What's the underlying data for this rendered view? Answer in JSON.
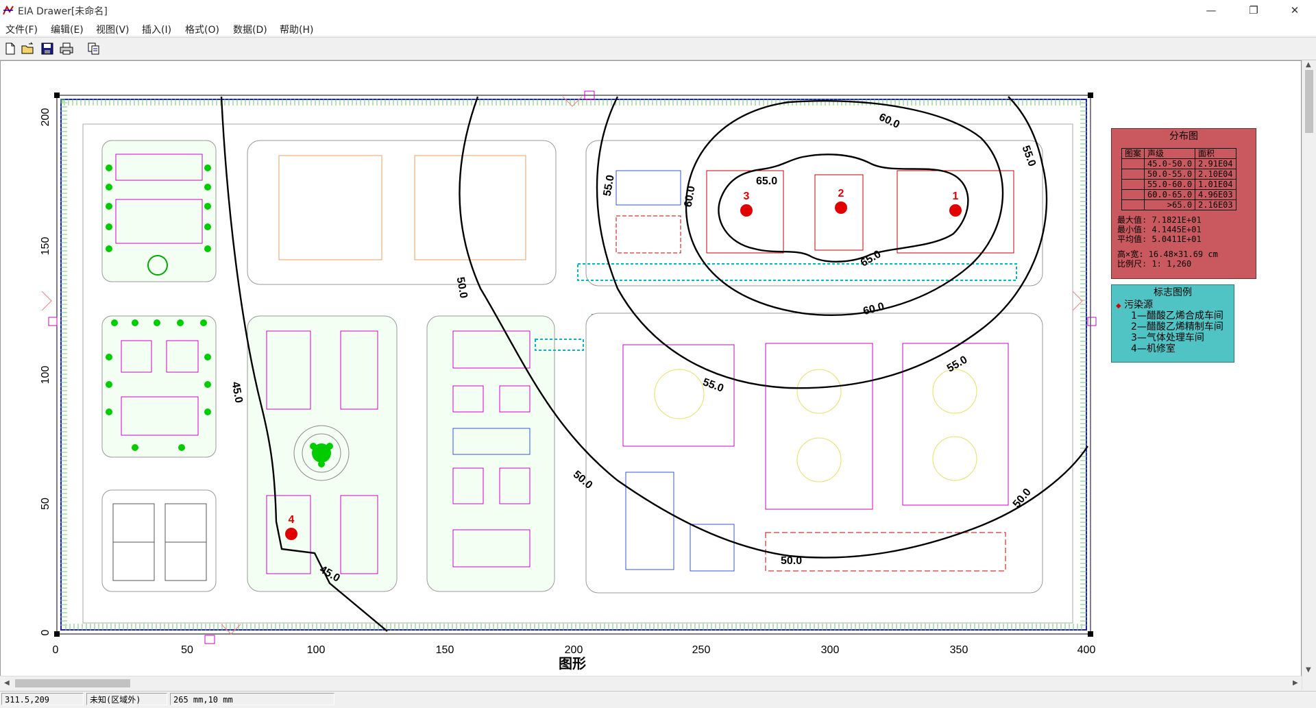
{
  "window": {
    "title": "EIA Drawer[未命名]",
    "controls": {
      "minimize": "—",
      "restore": "❐",
      "close": "✕"
    }
  },
  "menu": [
    "文件(F)",
    "编辑(E)",
    "视图(V)",
    "插入(I)",
    "格式(O)",
    "数据(D)",
    "帮助(H)"
  ],
  "toolbar": [
    "new-file-icon",
    "open-folder-icon",
    "save-icon",
    "print-icon",
    "copy-icon"
  ],
  "chart_data": {
    "type": "contour",
    "xlabel": "图形",
    "xlim": [
      0,
      400
    ],
    "ylim": [
      0,
      200
    ],
    "xticks": [
      "0",
      "50",
      "100",
      "150",
      "200",
      "250",
      "300",
      "350",
      "400"
    ],
    "yticks": [
      "0",
      "50",
      "100",
      "150",
      "200"
    ],
    "contour_levels": [
      "45.0",
      "50.0",
      "55.0",
      "60.0",
      "65.0"
    ],
    "sources": [
      {
        "id": "1",
        "x": 350,
        "y": 165
      },
      {
        "id": "2",
        "x": 305,
        "y": 166
      },
      {
        "id": "3",
        "x": 268,
        "y": 165
      },
      {
        "id": "4",
        "x": 90,
        "y": 38
      }
    ]
  },
  "distribution_legend": {
    "title": "分布图",
    "headers": [
      "图案",
      "声级",
      "面积"
    ],
    "rows": [
      [
        "",
        "45.0-50.0",
        "2.91E04"
      ],
      [
        "",
        "50.0-55.0",
        "2.10E04"
      ],
      [
        "",
        "55.0-60.0",
        "1.01E04"
      ],
      [
        "",
        "60.0-65.0",
        "4.96E03"
      ],
      [
        "",
        ">65.0",
        "2.16E03"
      ]
    ],
    "max": "最大值:  7.1821E+01",
    "min": "最小值:  4.1445E+01",
    "avg": "平均值:  5.0411E+01",
    "size": "高×宽:  16.48×31.69 cm",
    "scale": "比例尺:  1: 1,260"
  },
  "marker_legend": {
    "title": "标志图例",
    "category": "污染源",
    "items": [
      "1—醋酸乙烯合成车间",
      "2—醋酸乙烯精制车间",
      "3—气体处理车间",
      "4—机修室"
    ]
  },
  "status": {
    "coords": "311.5,209",
    "zone": "未知(区域外)",
    "paper": "265 mm,10 mm"
  },
  "colors": {
    "contour": "#000000",
    "source": "#e00000",
    "building_magenta": "#cc00cc",
    "building_blue": "#3355cc",
    "pipe_cyan": "#00b8c8",
    "tree_green": "#00cc00",
    "dist_legend_bg": "#c9595f",
    "marker_legend_bg": "#50c4c4"
  }
}
